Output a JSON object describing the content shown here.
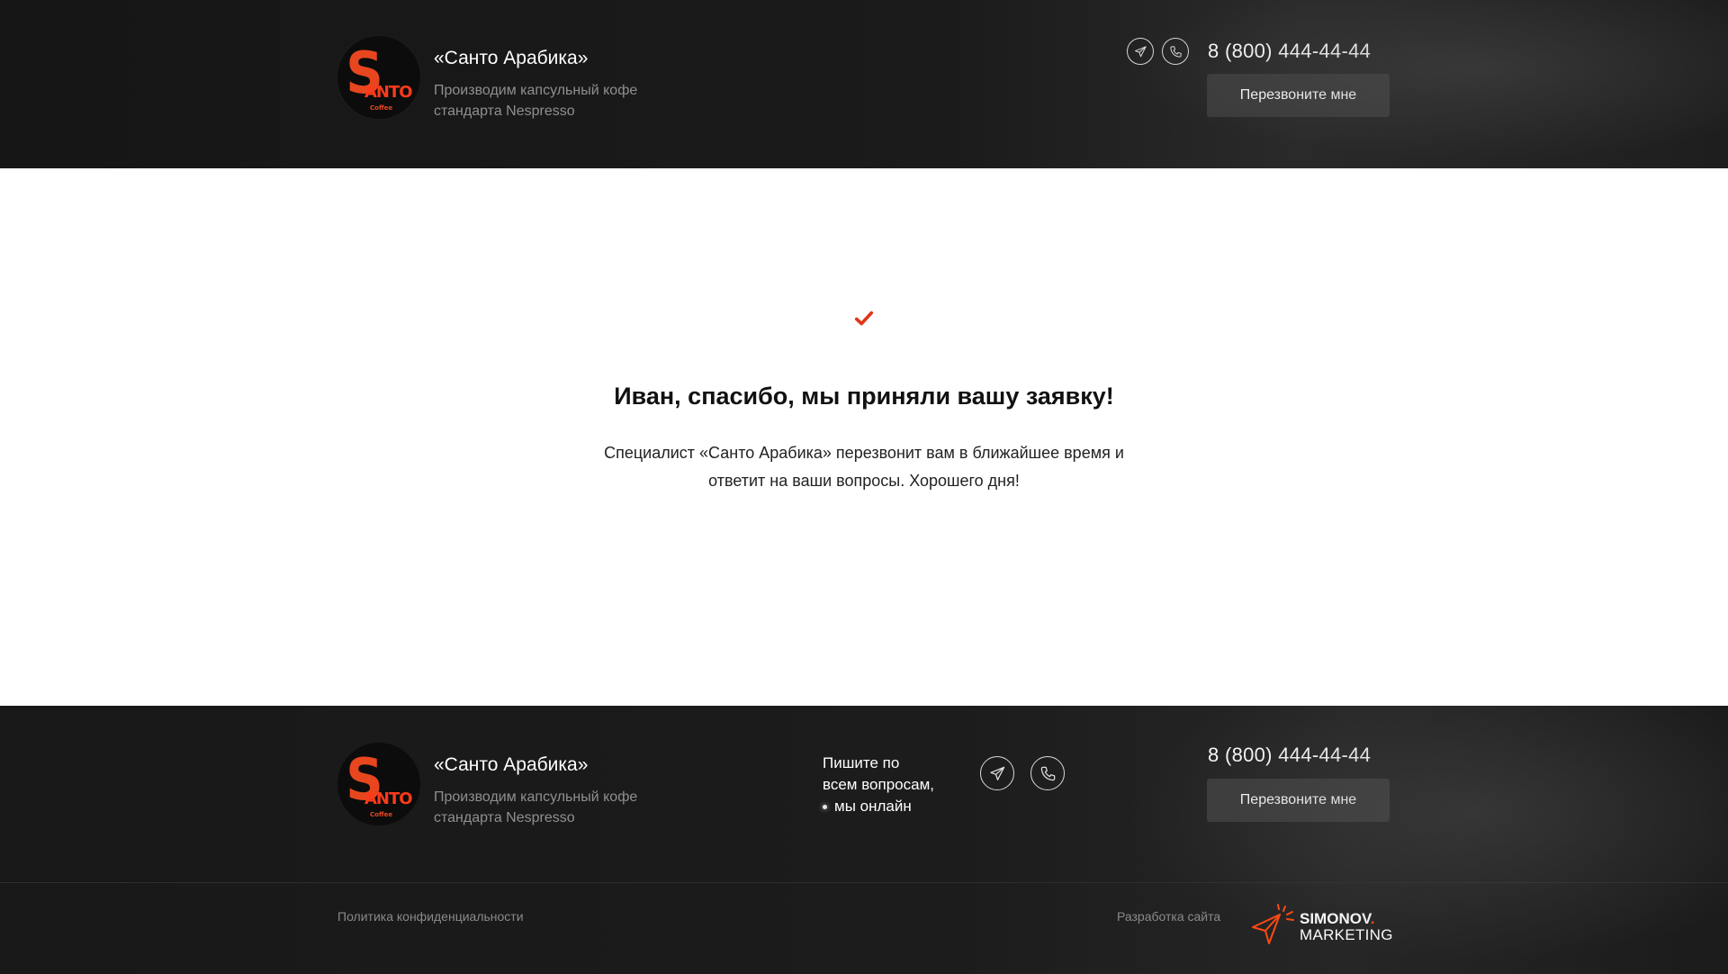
{
  "header": {
    "brand_name": "«Санто Арабика»",
    "brand_sub": "Производим капсульный кофе стандарта Nespresso",
    "logo_text": "ANTO",
    "logo_small": "Coffee",
    "phone": "8 (800) 444-44-44",
    "callback_label": "Перезвоните мне"
  },
  "main": {
    "title": "Иван, спасибо, мы приняли вашу заявку!",
    "text": "Специалист «Санто Арабика» перезвонит вам в ближайшее время и ответит на ваши вопросы. Хорошего дня!"
  },
  "footer": {
    "brand_name": "«Санто Арабика»",
    "brand_sub": "Производим капсульный кофе стандарта Nespresso",
    "logo_text": "ANTO",
    "logo_small": "Coffee",
    "write_us_line1": "Пишите по",
    "write_us_line2": "всем вопросам,",
    "online": "мы онлайн",
    "phone": "8 (800) 444-44-44",
    "callback_label": "Перезвоните мне",
    "policy": "Политика конфиденциальности",
    "dev_label": "Разработка сайта",
    "dev_logo_line1": "SIMONOV",
    "dev_logo_dot": ".",
    "dev_logo_line2": "MARKETING"
  },
  "colors": {
    "accent": "#e8461f",
    "dark_bg": "#1b1b1b",
    "button_bg": "#3b3b3b"
  },
  "icons": {
    "telegram": "telegram-icon",
    "phone": "phone-icon",
    "check": "check-icon"
  }
}
